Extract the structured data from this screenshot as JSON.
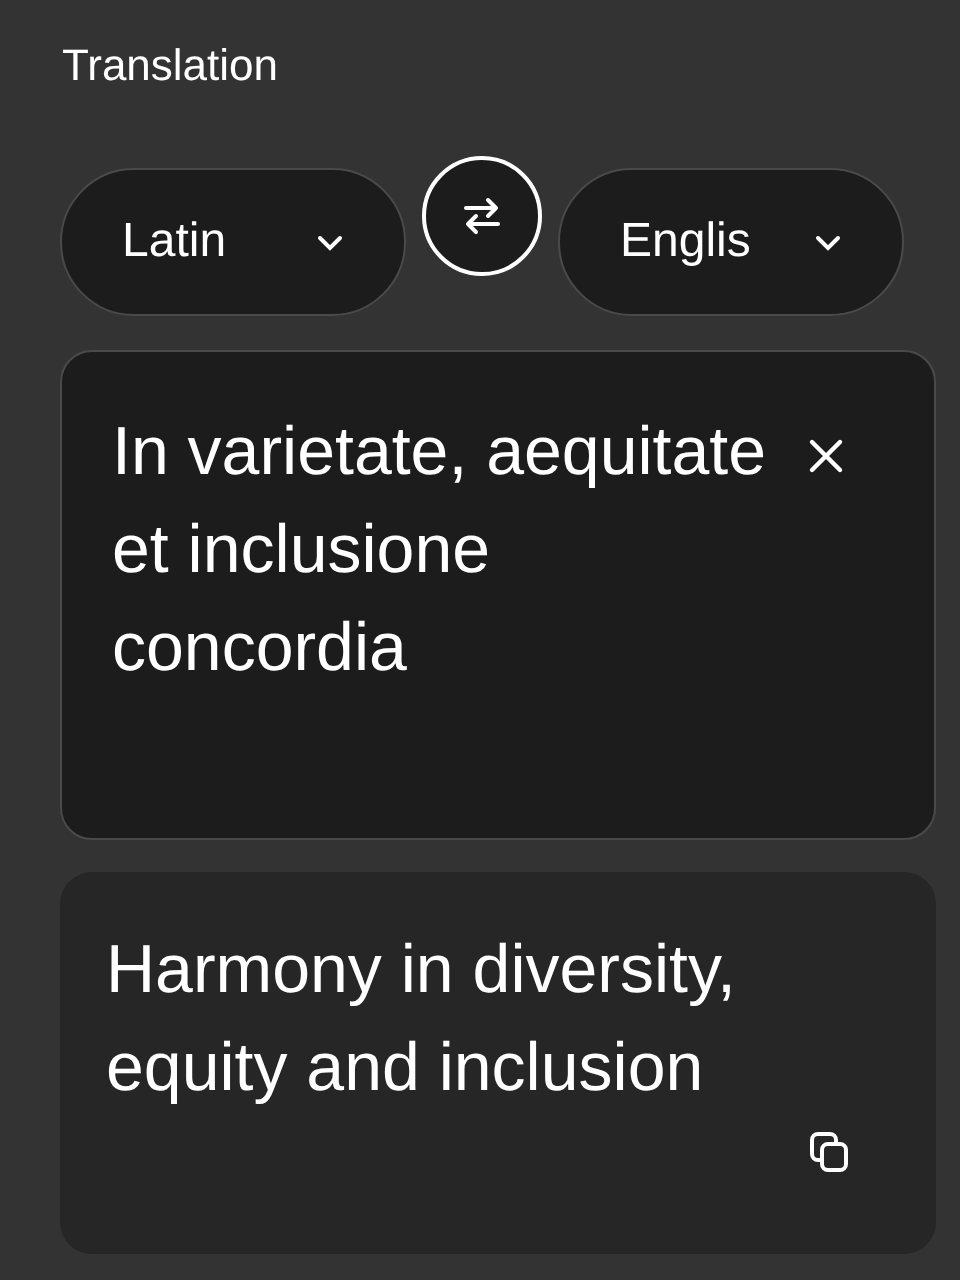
{
  "title": "Translation",
  "source_language": {
    "label": "Latin"
  },
  "target_language": {
    "label": "Englis"
  },
  "source_text": "In varietate, aequitate et inclusione concordia",
  "translated_text": "Harmony in diversity, equity and inclusion"
}
